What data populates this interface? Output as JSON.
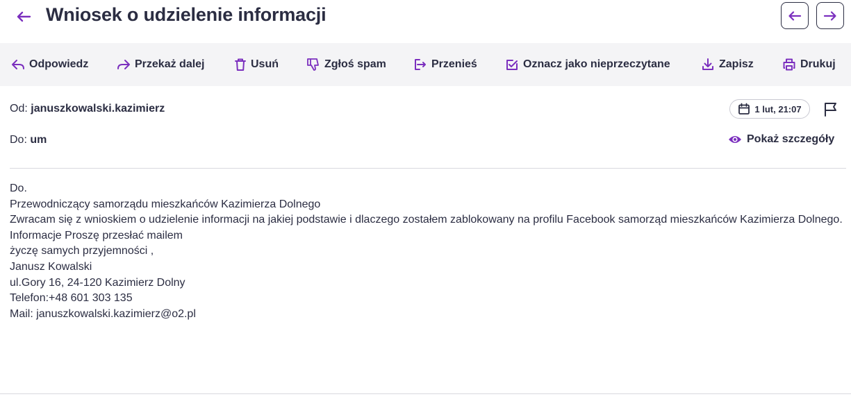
{
  "header": {
    "title": "Wniosek o udzielenie informacji"
  },
  "toolbar": {
    "reply": "Odpowiedz",
    "forward": "Przekaż dalej",
    "delete": "Usuń",
    "spam": "Zgłoś spam",
    "move": "Przenieś",
    "mark_unread": "Oznacz jako nieprzeczytane",
    "save": "Zapisz",
    "print": "Drukuj"
  },
  "message": {
    "from_label": "Od:",
    "from": "januszkowalski.kazimierz",
    "to_label": "Do:",
    "to": "um",
    "date": "1 lut, 21:07",
    "show_details": "Pokaż szczegóły",
    "body_lines": [
      "Do.",
      "Przewodniczący samorządu mieszkańców Kazimierza Dolnego",
      "Zwracam się z wnioskiem o udzielenie informacji na jakiej podstawie i dlaczego zostałem zablokowany na profilu Facebook samorząd mieszkańców Kazimierza Dolnego.",
      "Informacje Proszę przesłać mailem",
      "życzę samych przyjemności ,",
      "Janusz Kowalski",
      "ul.Gory 16, 24-120 Kazimierz Dolny",
      "Telefon:+48 601 303 135",
      "Mail: januszkowalski.kazimierz@o2.pl"
    ]
  },
  "colors": {
    "accent": "#7b2fbe",
    "text": "#2b2d42",
    "toolbar_bg": "#f4f4f6"
  },
  "icons": [
    "arrow-left-icon",
    "arrow-right-icon",
    "reply-icon",
    "forward-icon",
    "trash-icon",
    "thumb-down-icon",
    "move-icon",
    "mark-unread-icon",
    "download-icon",
    "print-icon",
    "calendar-icon",
    "flag-icon",
    "eye-icon"
  ]
}
